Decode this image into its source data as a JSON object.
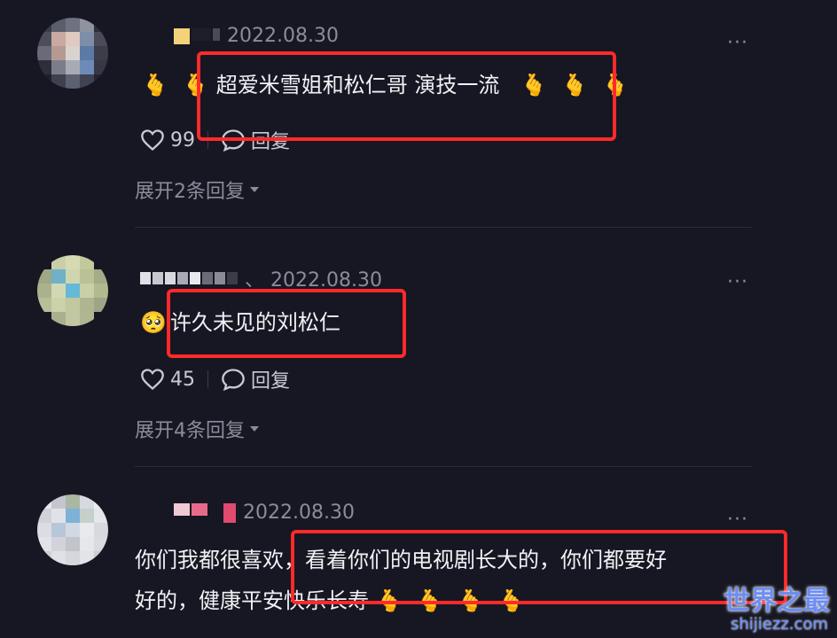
{
  "comments": [
    {
      "time": "2022.08.30",
      "text": "超爱米雪姐和松仁哥 演技一流",
      "likes": "99",
      "reply_label": "回复",
      "expand_label": "展开2条回复",
      "more": "···"
    },
    {
      "time": "、 2022.08.30",
      "text": "许久未见的刘松仁",
      "likes": "45",
      "reply_label": "回复",
      "expand_label": "展开4条回复",
      "more": "···"
    },
    {
      "time": "2022.08.30",
      "text_line1": "你们我都很喜欢，看着你们的电视剧长大的，你们都要好",
      "text_line2": "好的，健康平安快乐长寿",
      "more": "···"
    }
  ],
  "emoji": {
    "heart_hands": "🫰",
    "pleading": "🥺"
  },
  "colors": {
    "background": "#161722",
    "highlight": "#ff2a2a",
    "watermark": "#6d8df5"
  },
  "watermark": {
    "title": "世界之最",
    "subtitle": "shijiezz.com"
  }
}
